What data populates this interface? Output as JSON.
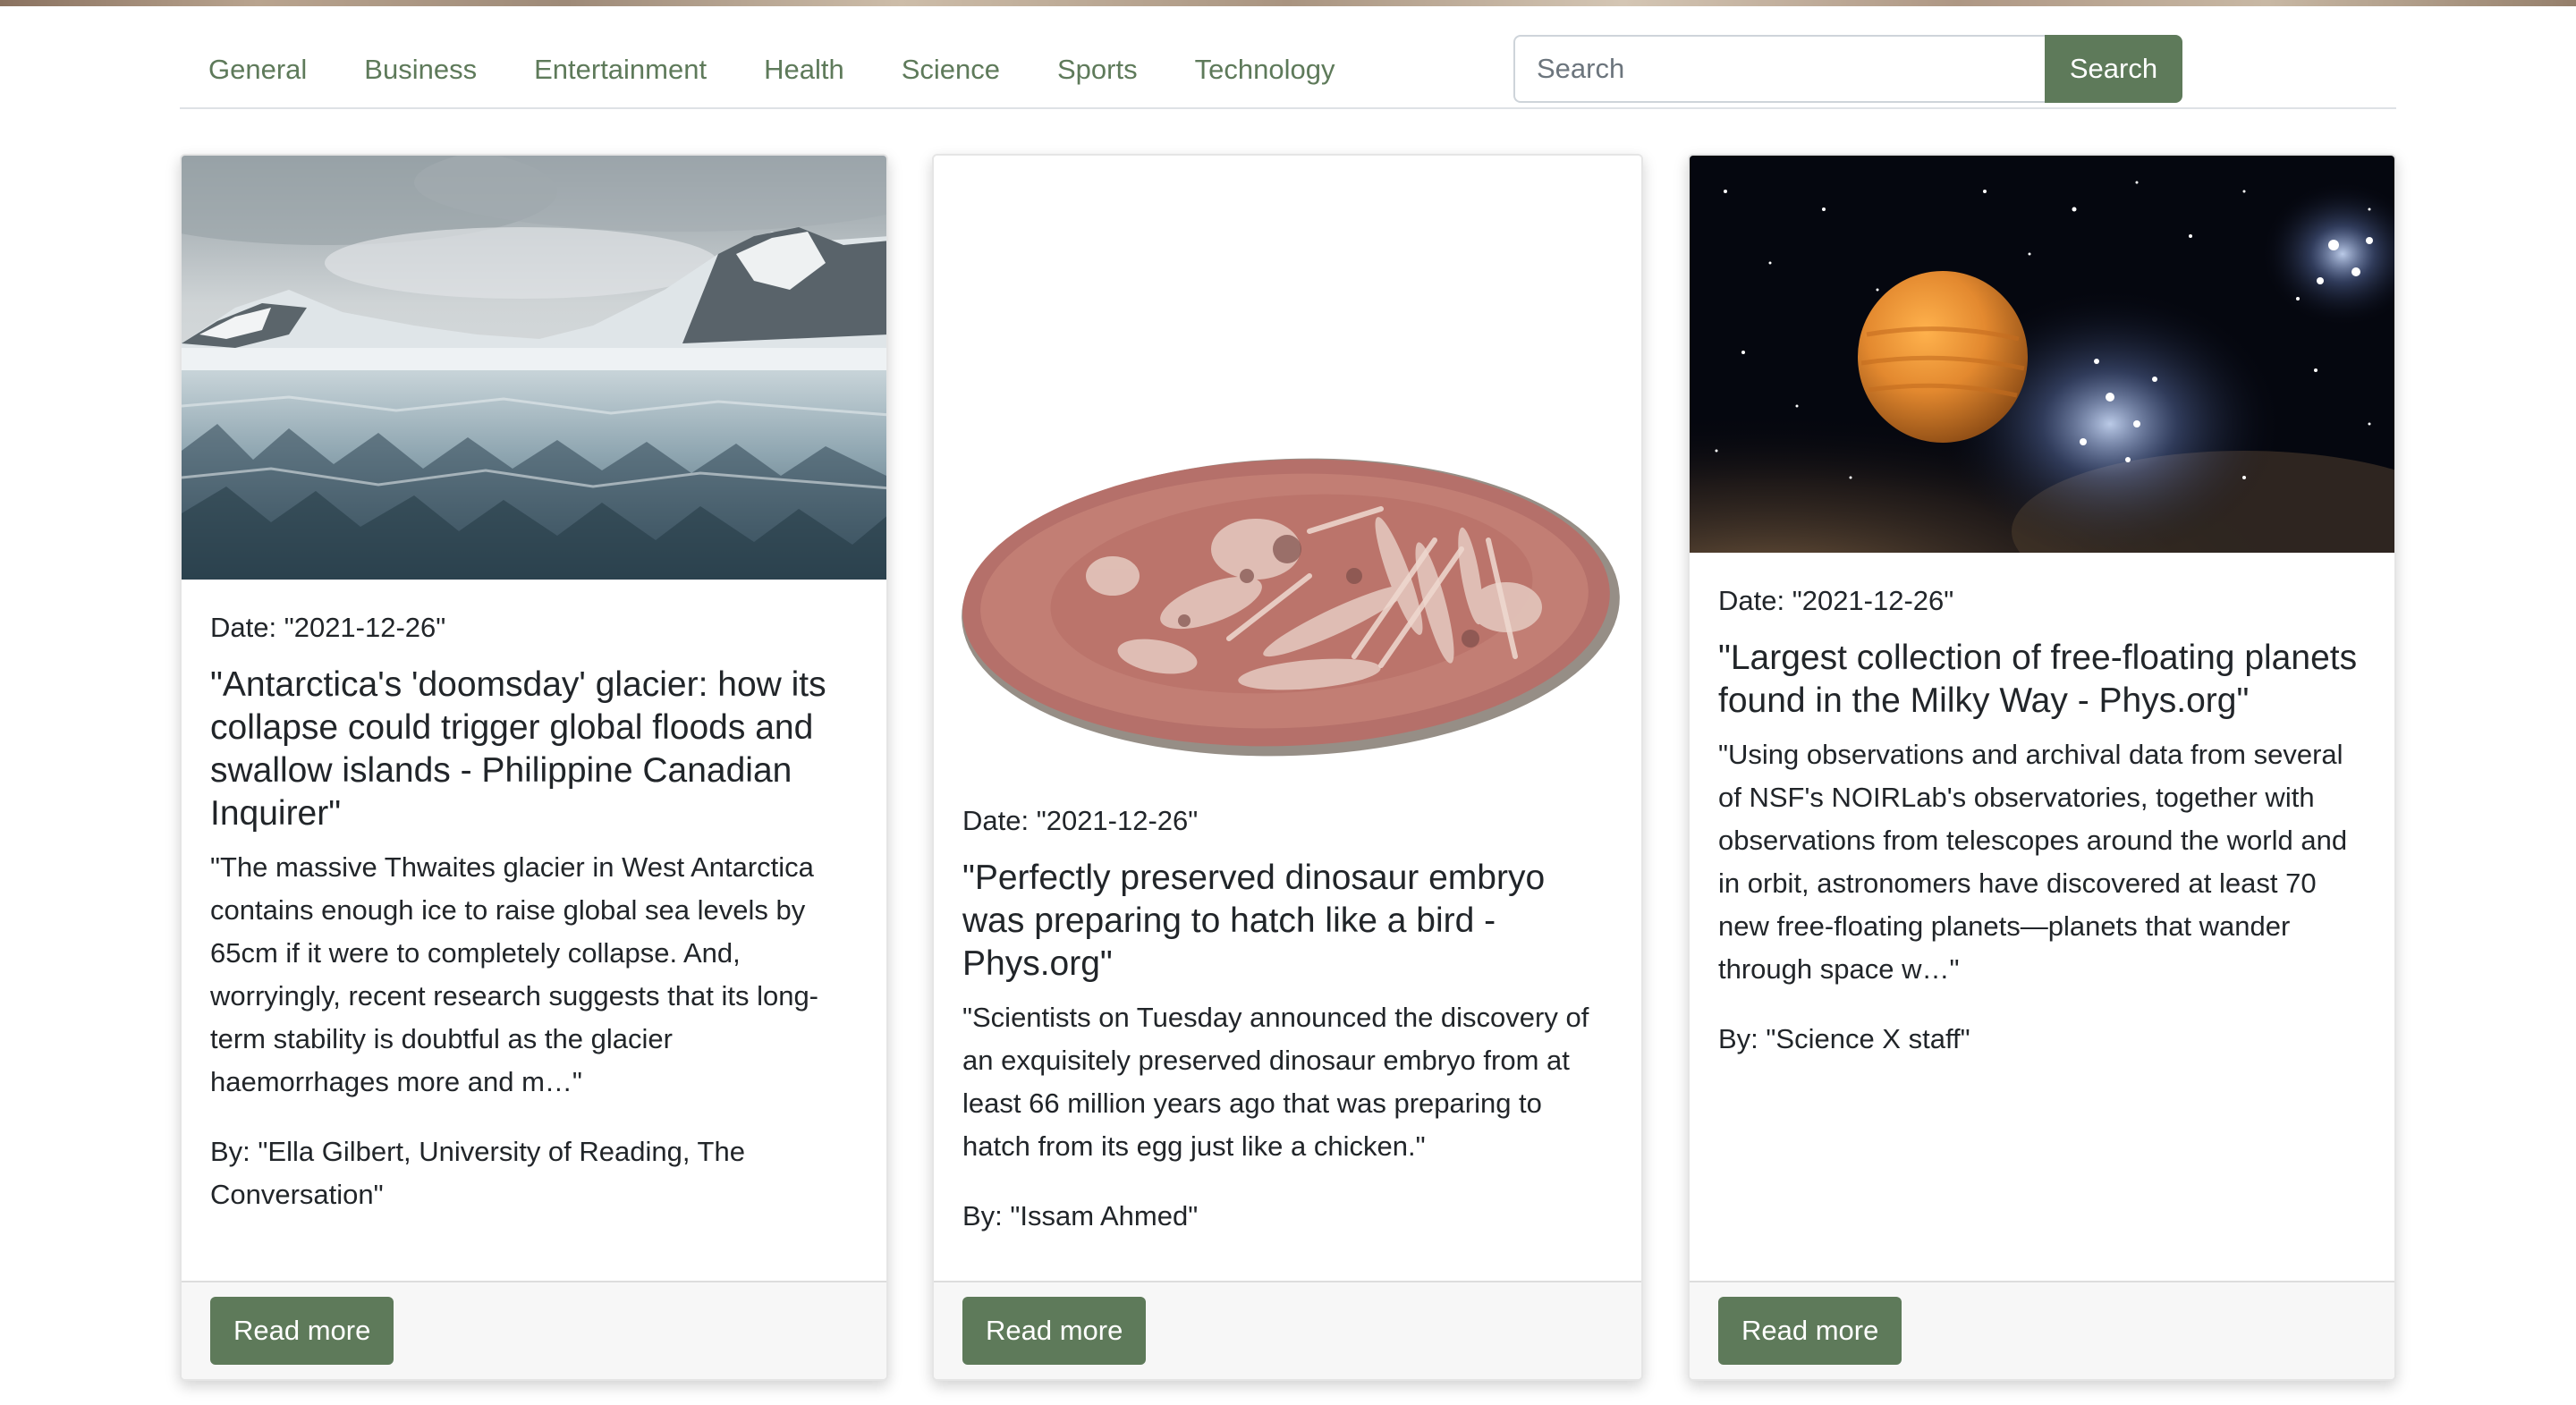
{
  "nav": {
    "categories": [
      "General",
      "Business",
      "Entertainment",
      "Health",
      "Science",
      "Sports",
      "Technology"
    ]
  },
  "search": {
    "placeholder": "Search",
    "button_label": "Search"
  },
  "articles": [
    {
      "image": "glacier-photo",
      "date": "Date: \"2021-12-26\"",
      "title": "\"Antarctica's 'doomsday' glacier: how its collapse could trigger global floods and swallow islands - Philippine Canadian Inquirer\"",
      "description": "\"The massive Thwaites glacier in West Antarctica contains enough ice to raise global sea levels by 65cm if it were to completely collapse. And, worryingly, recent research suggests that its long-term stability is doubtful as the glacier haemorrhages more and m…\"",
      "author": "By: \"Ella Gilbert, University of Reading, The Conversation\"",
      "button_label": "Read more"
    },
    {
      "image": "dinosaur-embryo-fossil-photo",
      "date": "Date: \"2021-12-26\"",
      "title": "\"Perfectly preserved dinosaur embryo was preparing to hatch like a bird - Phys.org\"",
      "description": "\"Scientists on Tuesday announced the discovery of an exquisitely preserved dinosaur embryo from at least 66 million years ago that was preparing to hatch from its egg just like a chicken.\"",
      "author": "By: \"Issam Ahmed\"",
      "button_label": "Read more"
    },
    {
      "image": "planet-starfield-illustration",
      "date": "Date: \"2021-12-26\"",
      "title": "\"Largest collection of free-floating planets found in the Milky Way - Phys.org\"",
      "description": "\"Using observations and archival data from several of NSF's NOIRLab's observatories, together with observations from telescopes around the world and in orbit, astronomers have discovered at least 70 new free-floating planets—planets that wander through space w…\"",
      "author": "By: \"Science X staff\"",
      "button_label": "Read more"
    }
  ],
  "colors": {
    "accent": "#5e7a5a",
    "footer_bg": "#f7f7f7",
    "text": "#212529"
  }
}
